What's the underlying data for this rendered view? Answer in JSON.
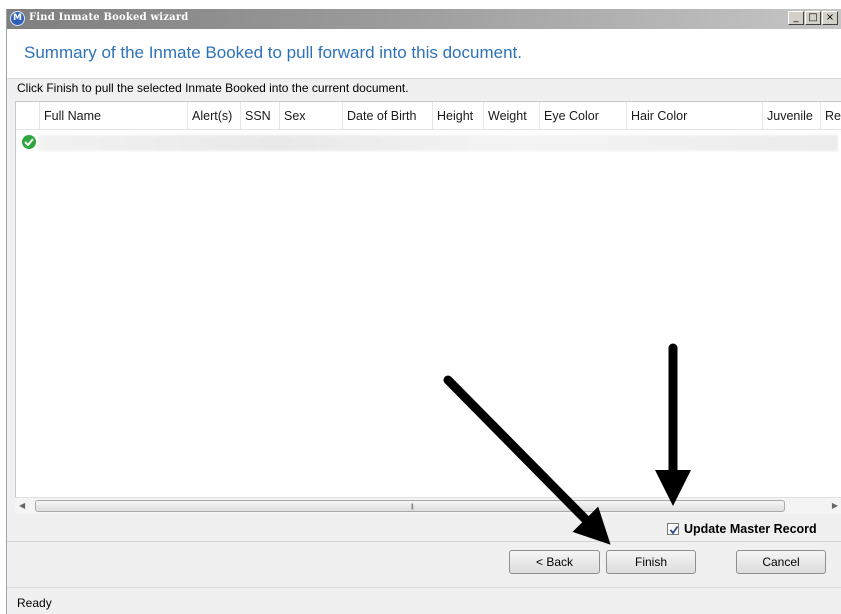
{
  "window": {
    "title": "Find Inmate Booked wizard",
    "app_icon_letter": "M",
    "controls": {
      "minimize": "_",
      "maximize": "□",
      "close": "×"
    }
  },
  "header": {
    "title": "Summary of the Inmate Booked to pull forward into this document."
  },
  "instruction": "Click Finish to pull the selected Inmate Booked into the current document.",
  "grid": {
    "columns": [
      "Full Name",
      "Alert(s)",
      "SSN",
      "Sex",
      "Date of Birth",
      "Height",
      "Weight",
      "Eye Color",
      "Hair Color",
      "Juvenile",
      "Re"
    ],
    "rows": [
      {
        "status_icon": "check-circle-icon",
        "values": []
      }
    ]
  },
  "options": {
    "update_master_record": {
      "label": "Update Master Record",
      "checked": true
    }
  },
  "buttons": {
    "back": "< Back",
    "finish": "Finish",
    "cancel": "Cancel"
  },
  "status": "Ready",
  "colors": {
    "header_title": "#2e72b8",
    "check_icon": "#2ea73f",
    "annotation_arrow": "#000000"
  }
}
